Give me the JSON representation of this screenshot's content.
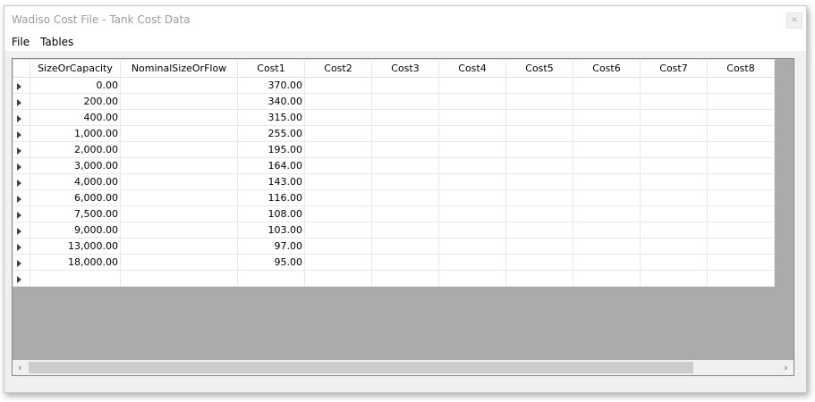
{
  "window": {
    "title": "Wadiso Cost File - Tank Cost Data",
    "close_glyph": "✕"
  },
  "menu": {
    "items": [
      {
        "label": "File"
      },
      {
        "label": "Tables"
      }
    ]
  },
  "grid": {
    "columns": [
      "SizeOrCapacity",
      "NominalSizeOrFlow",
      "Cost1",
      "Cost2",
      "Cost3",
      "Cost4",
      "Cost5",
      "Cost6",
      "Cost7",
      "Cost8"
    ],
    "rows": [
      {
        "size": "0.00",
        "nominal": "",
        "cost1": "370.00"
      },
      {
        "size": "200.00",
        "nominal": "",
        "cost1": "340.00"
      },
      {
        "size": "400.00",
        "nominal": "",
        "cost1": "315.00"
      },
      {
        "size": "1,000.00",
        "nominal": "",
        "cost1": "255.00"
      },
      {
        "size": "2,000.00",
        "nominal": "",
        "cost1": "195.00"
      },
      {
        "size": "3,000.00",
        "nominal": "",
        "cost1": "164.00"
      },
      {
        "size": "4,000.00",
        "nominal": "",
        "cost1": "143.00"
      },
      {
        "size": "6,000.00",
        "nominal": "",
        "cost1": "116.00"
      },
      {
        "size": "7,500.00",
        "nominal": "",
        "cost1": "108.00"
      },
      {
        "size": "9,000.00",
        "nominal": "",
        "cost1": "103.00"
      },
      {
        "size": "13,000.00",
        "nominal": "",
        "cost1": "97.00"
      },
      {
        "size": "18,000.00",
        "nominal": "",
        "cost1": "95.00"
      },
      {
        "size": "",
        "nominal": "",
        "cost1": ""
      }
    ]
  },
  "scrollbar": {
    "left_glyph": "‹",
    "right_glyph": "›"
  }
}
